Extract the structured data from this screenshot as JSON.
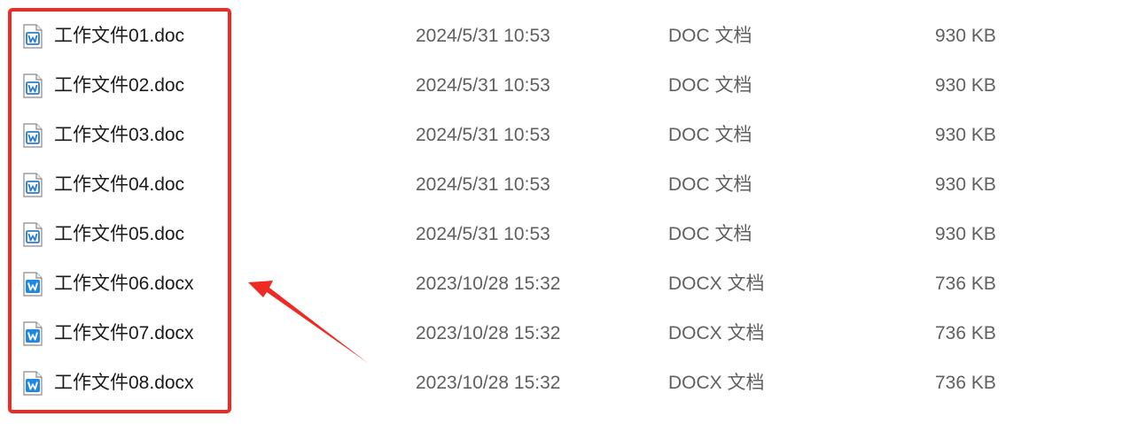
{
  "files": [
    {
      "name": "工作文件01.doc",
      "date": "2024/5/31 10:53",
      "type": "DOC 文档",
      "size": "930 KB",
      "icon": "doc-icon"
    },
    {
      "name": "工作文件02.doc",
      "date": "2024/5/31 10:53",
      "type": "DOC 文档",
      "size": "930 KB",
      "icon": "doc-icon"
    },
    {
      "name": "工作文件03.doc",
      "date": "2024/5/31 10:53",
      "type": "DOC 文档",
      "size": "930 KB",
      "icon": "doc-icon"
    },
    {
      "name": "工作文件04.doc",
      "date": "2024/5/31 10:53",
      "type": "DOC 文档",
      "size": "930 KB",
      "icon": "doc-icon"
    },
    {
      "name": "工作文件05.doc",
      "date": "2024/5/31 10:53",
      "type": "DOC 文档",
      "size": "930 KB",
      "icon": "doc-icon"
    },
    {
      "name": "工作文件06.docx",
      "date": "2023/10/28 15:32",
      "type": "DOCX 文档",
      "size": "736 KB",
      "icon": "docx-icon"
    },
    {
      "name": "工作文件07.docx",
      "date": "2023/10/28 15:32",
      "type": "DOCX 文档",
      "size": "736 KB",
      "icon": "docx-icon"
    },
    {
      "name": "工作文件08.docx",
      "date": "2023/10/28 15:32",
      "type": "DOCX 文档",
      "size": "736 KB",
      "icon": "docx-icon"
    }
  ],
  "colors": {
    "annotation": "#ee2a24",
    "doc_icon_blue": "#2b7cd3",
    "docx_icon_blue": "#1e88e5"
  }
}
